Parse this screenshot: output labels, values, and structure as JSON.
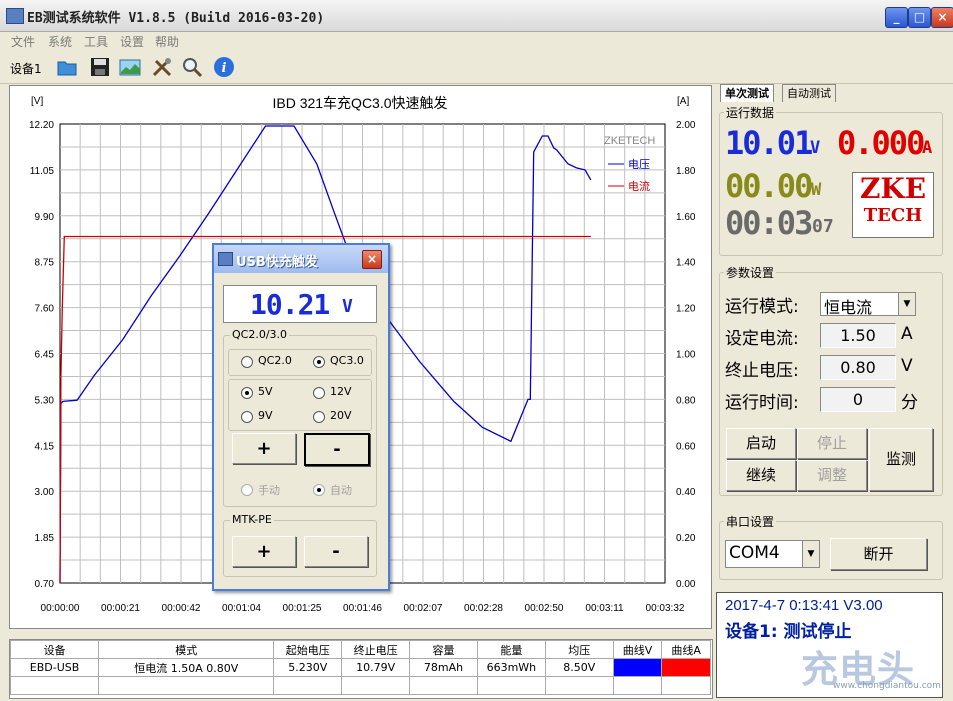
{
  "window": {
    "title": "EB测试系统软件 V1.8.5 (Build 2016-03-20)",
    "min": "_",
    "max": "□",
    "close": "×"
  },
  "menu": [
    "文件",
    "系统",
    "工具",
    "设置",
    "帮助"
  ],
  "toolbar": {
    "device_tab": "设备1",
    "icons": [
      "open-folder-icon",
      "save-icon",
      "chart-image-icon",
      "tools-icon",
      "zoom-icon",
      "info-icon"
    ]
  },
  "chart_data": {
    "type": "line",
    "title": "IBD 321车充QC3.0快速触发",
    "left_unit": "[V]",
    "right_unit": "[A]",
    "watermark": "ZKETECH",
    "y_left_ticks": [
      "12.20",
      "11.05",
      "9.90",
      "8.75",
      "7.60",
      "6.45",
      "5.30",
      "4.15",
      "3.00",
      "1.85",
      "0.70"
    ],
    "y_right_ticks": [
      "2.00",
      "1.80",
      "1.60",
      "1.40",
      "1.20",
      "1.00",
      "0.80",
      "0.60",
      "0.40",
      "0.20",
      "0.00"
    ],
    "x_ticks": [
      "00:00:00",
      "00:00:21",
      "00:00:42",
      "00:01:04",
      "00:01:25",
      "00:01:46",
      "00:02:07",
      "00:02:28",
      "00:02:50",
      "00:03:11",
      "00:03:32"
    ],
    "ylim_left": [
      0.7,
      12.2
    ],
    "ylim_right": [
      0,
      2.0
    ],
    "xlim_seconds": [
      0,
      212
    ],
    "grid": true,
    "legend_position": "top-right",
    "series": [
      {
        "name": "电压",
        "color": "#0000cc",
        "axis": "left",
        "x": [
          0,
          0.3,
          1,
          6,
          12,
          22,
          32,
          42,
          52,
          62,
          72,
          82,
          90,
          96,
          104,
          114,
          126,
          138,
          148,
          158,
          164,
          164.8,
          166,
          169,
          171,
          173,
          174,
          178,
          181,
          184,
          186
        ],
        "y": [
          0.7,
          5.2,
          5.25,
          5.28,
          5.9,
          6.8,
          7.9,
          8.9,
          9.95,
          11.05,
          12.15,
          12.15,
          11.2,
          10.0,
          8.45,
          7.4,
          6.25,
          5.25,
          4.6,
          4.25,
          5.3,
          5.3,
          11.5,
          11.9,
          11.9,
          11.6,
          11.55,
          11.2,
          11.1,
          11.05,
          10.8
        ]
      },
      {
        "name": "电流",
        "color": "#cc0000",
        "axis": "right",
        "x": [
          0,
          0.3,
          0.8,
          1.5,
          186
        ],
        "y": [
          0.0,
          0.9,
          1.2,
          1.51,
          1.51
        ]
      }
    ]
  },
  "right_panel": {
    "tabs": [
      "单次测试",
      "自动测试"
    ],
    "run_data_label": "运行数据",
    "voltage": "10.01",
    "voltage_unit": "V",
    "current": "0.000",
    "current_unit": "A",
    "power": "00.00",
    "power_unit": "W",
    "time": "00:03",
    "time_sub": "07",
    "logo_top": "ZKE",
    "logo_bottom": "TECH",
    "params_label": "参数设置",
    "mode_label": "运行模式:",
    "mode_value": "恒电流",
    "set_current_label": "设定电流:",
    "set_current_value": "1.50",
    "set_current_unit": "A",
    "end_voltage_label": "终止电压:",
    "end_voltage_value": "0.80",
    "end_voltage_unit": "V",
    "run_time_label": "运行时间:",
    "run_time_value": "0",
    "run_time_unit": "分",
    "btn_start": "启动",
    "btn_stop": "停止",
    "btn_continue": "继续",
    "btn_adjust": "调整",
    "btn_monitor": "监测",
    "serial_label": "串口设置",
    "port_value": "COM4",
    "btn_disconnect": "断开",
    "status_line1": "2017-4-7 0:13:41  V3.00",
    "status_line2": "设备1: 测试停止",
    "brand": "充电头",
    "brand_url": "www.chongdiantou.com"
  },
  "dialog": {
    "title": "USB快充触发",
    "close": "×",
    "display_value": "10.21",
    "display_unit": "V",
    "qc_group": "QC2.0/3.0",
    "qc_options": [
      "QC2.0",
      "QC3.0"
    ],
    "qc_selected": "QC3.0",
    "volt_options": [
      "5V",
      "12V",
      "9V",
      "20V"
    ],
    "volt_selected": "5V",
    "plus": "+",
    "minus": "-",
    "manual": "手动",
    "auto": "自动",
    "mtk_group": "MTK-PE",
    "mtk_plus": "+",
    "mtk_minus": "-"
  },
  "table": {
    "headers": [
      "设备",
      "模式",
      "起始电压",
      "终止电压",
      "容量",
      "能量",
      "均压",
      "曲线V",
      "曲线A"
    ],
    "row": [
      "EBD-USB",
      "恒电流 1.50A 0.80V",
      "5.230V",
      "10.79V",
      "78mAh",
      "663mWh",
      "8.50V",
      "",
      ""
    ],
    "curve_colors": [
      "#0000ff",
      "#ff0000"
    ]
  }
}
